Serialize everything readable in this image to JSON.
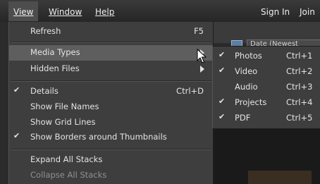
{
  "menubar": {
    "view": "View",
    "window": "Window",
    "help": "Help",
    "sign_in": "Sign In",
    "join": "Join"
  },
  "background": {
    "sort_label": "Date (Newest"
  },
  "view_menu": {
    "refresh": {
      "label": "Refresh",
      "shortcut": "F5"
    },
    "media_types": {
      "label": "Media Types"
    },
    "hidden_files": {
      "label": "Hidden Files"
    },
    "details": {
      "label": "Details",
      "shortcut": "Ctrl+D",
      "checked": true
    },
    "show_file_names": {
      "label": "Show File Names"
    },
    "show_grid_lines": {
      "label": "Show Grid Lines"
    },
    "show_borders": {
      "label": "Show Borders around Thumbnails",
      "checked": true
    },
    "expand_all_stacks": {
      "label": "Expand All Stacks"
    },
    "collapse_all_stacks": {
      "label": "Collapse All Stacks"
    }
  },
  "media_types_submenu": [
    {
      "label": "Photos",
      "shortcut": "Ctrl+1",
      "checked": true
    },
    {
      "label": "Video",
      "shortcut": "Ctrl+2",
      "checked": true
    },
    {
      "label": "Audio",
      "shortcut": "Ctrl+3",
      "checked": false
    },
    {
      "label": "Projects",
      "shortcut": "Ctrl+4",
      "checked": true
    },
    {
      "label": "PDF",
      "shortcut": "Ctrl+5",
      "checked": true
    }
  ],
  "check_glyph": "✔",
  "colors": {
    "menu_bg": "#3e3e3e",
    "highlight": "#5e5e5e",
    "menubar": "#262626"
  }
}
